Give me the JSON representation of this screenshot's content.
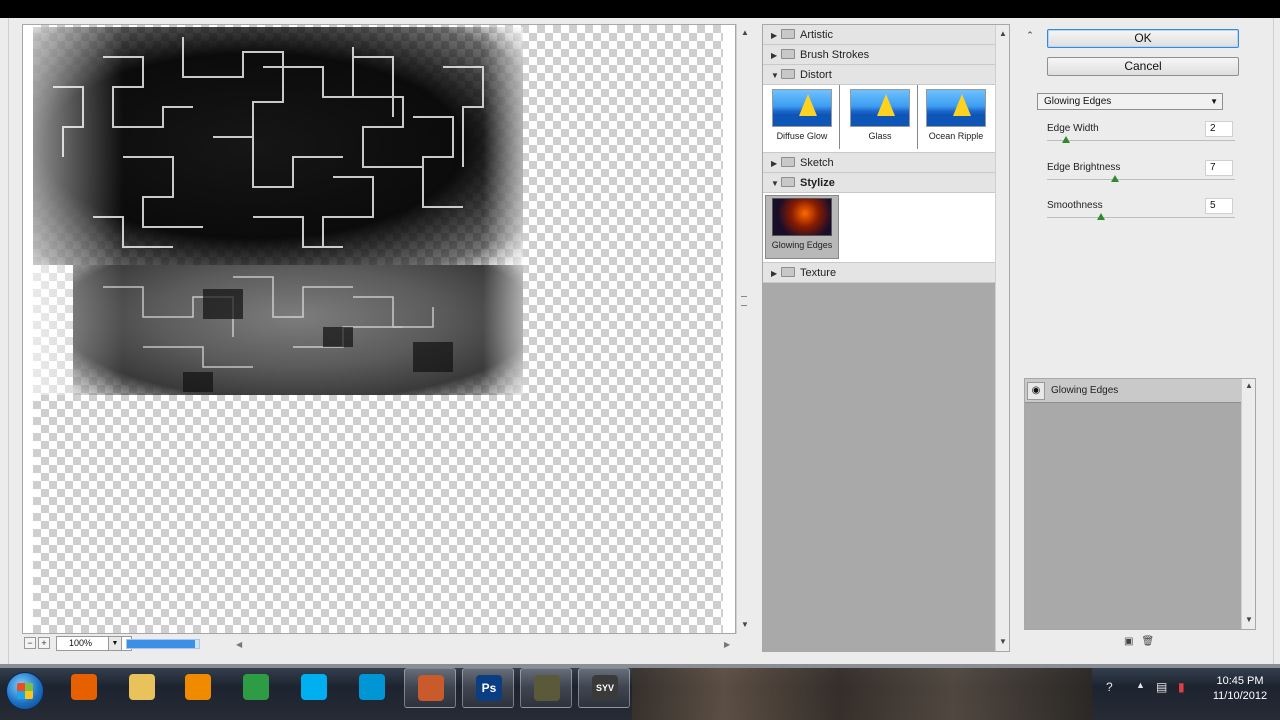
{
  "preview": {
    "zoom": "100%",
    "progress_fraction": 0.95
  },
  "filters": {
    "categories": [
      {
        "label": "Artistic"
      },
      {
        "label": "Brush Strokes"
      },
      {
        "label": "Distort",
        "items": [
          "Diffuse Glow",
          "Glass",
          "Ocean Ripple"
        ]
      },
      {
        "label": "Sketch"
      },
      {
        "label": "Stylize",
        "items": [
          "Glowing Edges"
        ],
        "selected": "Glowing Edges"
      },
      {
        "label": "Texture"
      }
    ]
  },
  "buttons": {
    "ok": "OK",
    "cancel": "Cancel"
  },
  "filter_select": {
    "value": "Glowing Edges"
  },
  "params": [
    {
      "label": "Edge Width",
      "value": "2",
      "fraction": 0.08
    },
    {
      "label": "Edge Brightness",
      "value": "7",
      "fraction": 0.35
    },
    {
      "label": "Smoothness",
      "value": "5",
      "fraction": 0.27
    }
  ],
  "layers": {
    "items": [
      {
        "label": "Glowing Edges",
        "visible": true
      }
    ]
  },
  "taskbar": {
    "apps": [
      {
        "name": "firefox-icon",
        "color": "#e66000"
      },
      {
        "name": "folder-icon",
        "color": "#e8c25a"
      },
      {
        "name": "media-player-icon",
        "color": "#f08a00"
      },
      {
        "name": "chrome-icon",
        "color": "#2e9b45"
      },
      {
        "name": "skype-icon",
        "color": "#00aff0"
      },
      {
        "name": "hp-icon",
        "color": "#0096d6"
      },
      {
        "name": "app-icon",
        "color": "#c85a2b"
      },
      {
        "name": "photoshop-icon",
        "color": "#0a3d82",
        "glyph": "Ps"
      },
      {
        "name": "camera-icon",
        "color": "#5a5a3a"
      },
      {
        "name": "syv-icon",
        "color": "#3a3a3a",
        "glyph": "SYV"
      }
    ],
    "clock_time": "10:45 PM",
    "clock_date": "11/10/2012"
  }
}
